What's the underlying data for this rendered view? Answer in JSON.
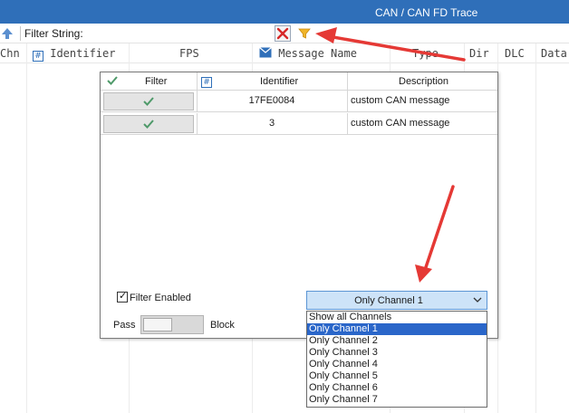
{
  "window": {
    "title": "CAN / CAN FD Trace"
  },
  "filter_bar": {
    "label": "Filter String:",
    "up_icon": "arrow-up-icon",
    "clear_icon": "red-x-icon",
    "filter_icon": "funnel-icon"
  },
  "columns": [
    {
      "label": "Chn"
    },
    {
      "label": "Identifier",
      "icon": "hash-icon"
    },
    {
      "label": "FPS"
    },
    {
      "label": "Message Name",
      "icon": "envelope-icon"
    },
    {
      "label": "Type"
    },
    {
      "label": "Dir"
    },
    {
      "label": "DLC"
    },
    {
      "label": "Data"
    }
  ],
  "filter_popup": {
    "headers": {
      "filter": "Filter",
      "identifier": "Identifier",
      "description": "Description",
      "check_icon": "checkmark-icon",
      "hash_icon": "hash-icon"
    },
    "rows": [
      {
        "enabled_icon": "checkmark-icon",
        "identifier": "17FE0084",
        "description": "custom CAN message"
      },
      {
        "enabled_icon": "checkmark-icon",
        "identifier": "3",
        "description": "custom CAN message"
      }
    ],
    "filter_enabled_label": "Filter Enabled",
    "pass_label": "Pass",
    "block_label": "Block",
    "channel_select": {
      "value": "Only Channel 1",
      "options": [
        "Show all Channels",
        "Only Channel 1",
        "Only Channel 2",
        "Only Channel 3",
        "Only Channel 4",
        "Only Channel 5",
        "Only Channel 6",
        "Only Channel 7"
      ],
      "selected_index": 1
    }
  },
  "colors": {
    "titlebar": "#2f6fb9",
    "selection": "#2a66c9",
    "annotation_arrow": "#e53935",
    "check": "#4f9a6a"
  }
}
